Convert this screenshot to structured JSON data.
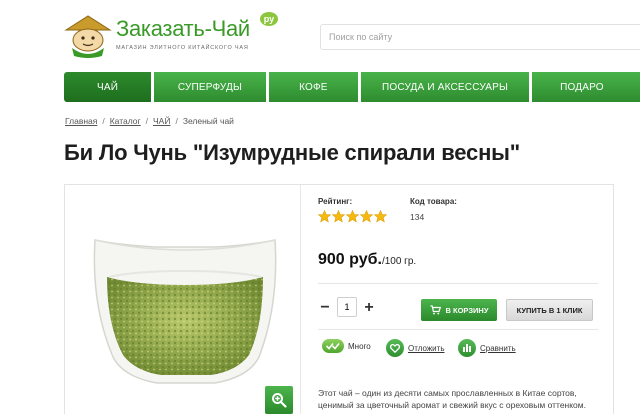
{
  "header": {
    "logo_title": "Заказать-Чай",
    "logo_ru": "ру",
    "logo_subtitle": "магазин элитного китайского чая",
    "search_placeholder": "Поиск по сайту"
  },
  "nav": {
    "items": [
      {
        "label": "ЧАЙ"
      },
      {
        "label": "СУПЕРФУДЫ"
      },
      {
        "label": "КОФЕ"
      },
      {
        "label": "ПОСУДА И АКСЕССУАРЫ"
      },
      {
        "label": "ПОДАРО"
      }
    ]
  },
  "breadcrumbs": {
    "items": [
      "Главная",
      "Каталог",
      "ЧАЙ"
    ],
    "current": "Зеленый чай",
    "separator": "/"
  },
  "product": {
    "title": "Би Ло Чунь \"Изумрудные спирали весны\"",
    "rating_label": "Рейтинг:",
    "rating": 5,
    "rating_max": 5,
    "code_label": "Код товара:",
    "code_value": "134",
    "price": "900 руб.",
    "price_unit": "/100 гр.",
    "quantity": "1",
    "cart_button": "В КОРЗИНУ",
    "oneclick_button": "КУПИТЬ В 1 КЛИК",
    "stock_label": "Много",
    "postpone_label": "Отложить",
    "compare_label": "Сравнить",
    "description": "Этот чай – один из десяти самых прославленных в Китае сортов, ценимый за цветочный аромат и свежий вкус с ореховым оттенком."
  },
  "colors": {
    "brand_green": "#3a9a28",
    "nav_green": "#2e8c2f",
    "star_yellow": "#f6b90f"
  }
}
